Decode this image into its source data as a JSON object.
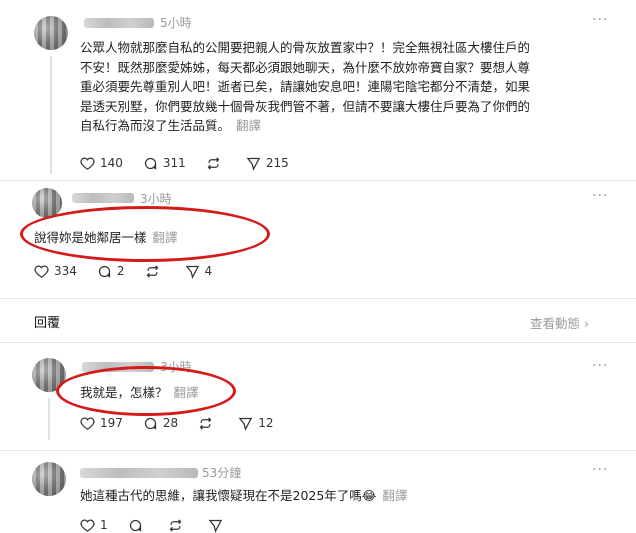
{
  "comments": [
    {
      "time": "5小時",
      "more": "···",
      "lines": [
        "公眾人物就那麼自私的公開要把親人的骨灰放置家中？！完全無視社區大樓住戶的",
        "不安！既然那麼愛姊姊，每天都必須跟她聊天，為什麼不放妳帝寶自家？要想人尊",
        "重必須要先尊重別人吧！逝者已矣，請讓她安息吧！連陽宅陰宅都分不清楚，如果",
        "是透天別墅，你們要放幾十個骨灰我們管不著，但請不要讓大樓住戶要為了你們的",
        "自私行為而沒了生活品質。"
      ],
      "translate": "翻譯",
      "likes": "140",
      "replies": "311",
      "shares": "215"
    },
    {
      "time": "3小時",
      "more": "···",
      "text": "說得妳是她鄰居一樣",
      "translate": "翻譯",
      "likes": "334",
      "replies": "2",
      "shares": "4"
    },
    {
      "time": "3小時",
      "more": "···",
      "text": "我就是，怎樣？",
      "translate": "翻譯",
      "likes": "197",
      "replies": "28",
      "shares": "12"
    },
    {
      "time": "53分鐘",
      "more": "···",
      "text": "她這種古代的思維，讓我懷疑現在不是2025年了嗎😂",
      "translate": "翻譯",
      "likes": "1"
    }
  ],
  "section": {
    "title": "回覆",
    "view_activity": "查看動態 ›"
  },
  "colors": {
    "highlight": "#d51a1a",
    "muted": "#9a9a9a"
  }
}
